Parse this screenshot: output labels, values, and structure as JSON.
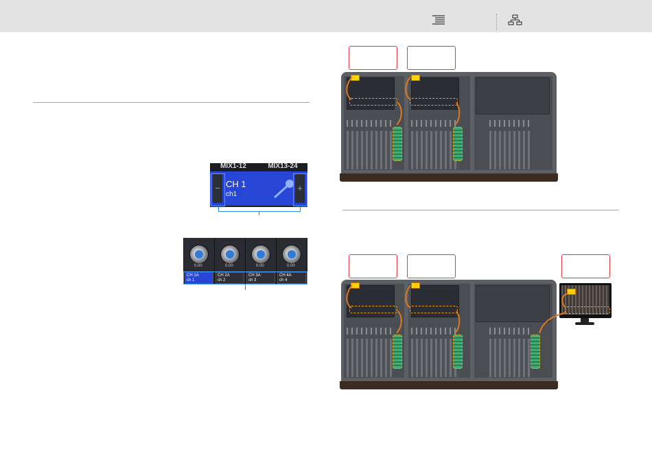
{
  "toolbar": {
    "toc_icon": "table-of-contents-icon",
    "sitemap_icon": "sitemap-icon"
  },
  "screen_crop_1": {
    "tabs": [
      "MIX1-12",
      "MIX13-24"
    ],
    "channel_name": "CH 1",
    "channel_sub": "ch1",
    "minus": "−",
    "plus": "+"
  },
  "screen_crop_2": {
    "knob_value": "0.00",
    "slots": [
      {
        "name": "CH 1A",
        "sub": "ch 1"
      },
      {
        "name": "CH 2A",
        "sub": "ch 2"
      },
      {
        "name": "CH 3A",
        "sub": "ch 3"
      },
      {
        "name": "CH 4A",
        "sub": "ch 4"
      }
    ]
  },
  "colors": {
    "toolbar_bg": "#e3e3e3",
    "callout_border": "#e0393c",
    "highlight_dash": "#f0a020",
    "selection_blue": "#4aa3ff",
    "channel_blue": "#2846d6"
  }
}
